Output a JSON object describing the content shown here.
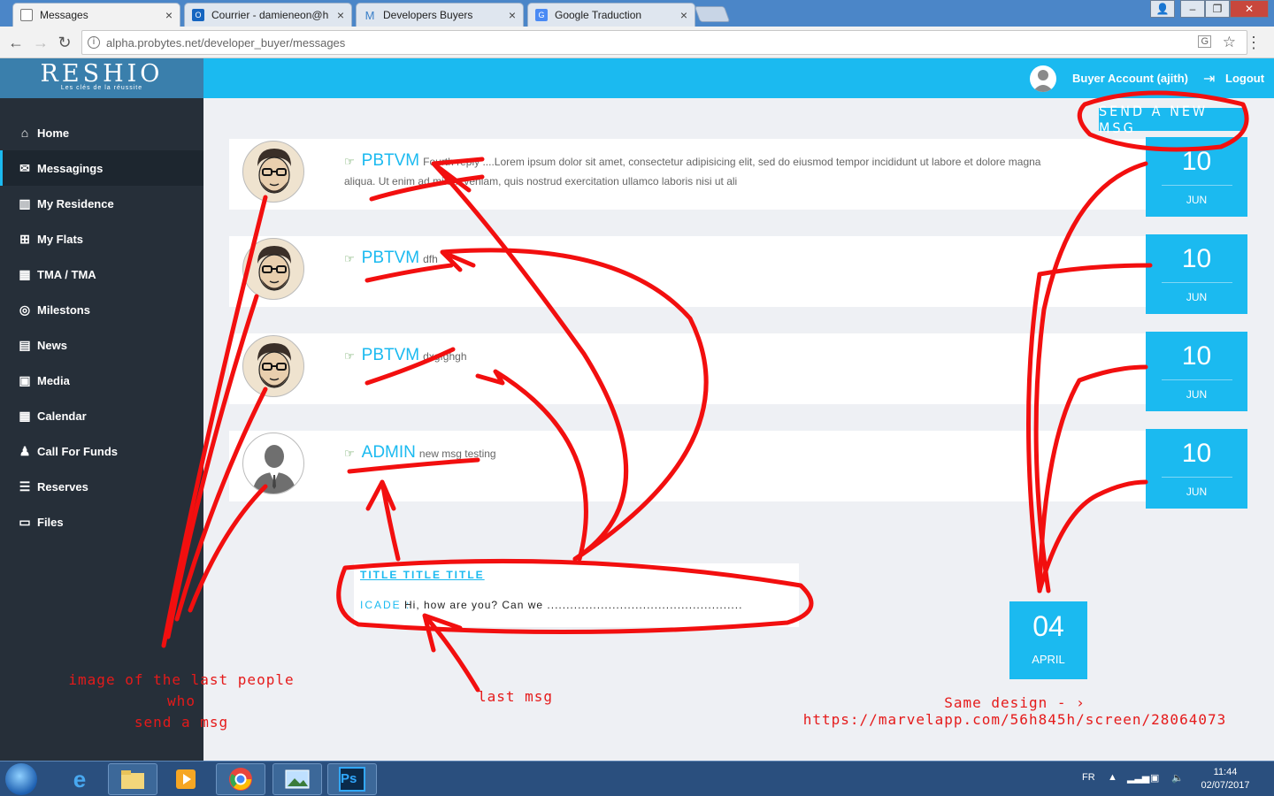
{
  "browser": {
    "tabs": [
      {
        "label": "Messages",
        "icon": "document-icon",
        "active": true
      },
      {
        "label": "Courrier - damieneon@h",
        "icon": "outlook-icon",
        "active": false
      },
      {
        "label": "Developers Buyers",
        "icon": "marvel-icon",
        "active": false
      },
      {
        "label": "Google Traduction",
        "icon": "google-translate-icon",
        "active": false
      }
    ],
    "url": "alpha.probytes.net/developer_buyer/messages",
    "window_controls": {
      "minimize": "–",
      "maximize": "❐",
      "close": "✕"
    }
  },
  "app": {
    "logo_main": "RESHIO",
    "logo_tagline": "Les clés de la réussite",
    "account_label": "Buyer Account (ajith)",
    "logout_label": "Logout",
    "accent_color": "#1bbaf0",
    "sidebar_color": "#262f39"
  },
  "sidebar": {
    "items": [
      {
        "label": "Home",
        "icon": "home-icon",
        "active": false
      },
      {
        "label": "Messagings",
        "icon": "envelope-icon",
        "active": true
      },
      {
        "label": "My Residence",
        "icon": "building-icon",
        "active": false
      },
      {
        "label": "My Flats",
        "icon": "grid-icon",
        "active": false
      },
      {
        "label": "TMA / TMA",
        "icon": "tma-icon",
        "active": false
      },
      {
        "label": "Milestons",
        "icon": "target-icon",
        "active": false
      },
      {
        "label": "News",
        "icon": "newspaper-icon",
        "active": false
      },
      {
        "label": "Media",
        "icon": "image-icon",
        "active": false
      },
      {
        "label": "Calendar",
        "icon": "calendar-icon",
        "active": false
      },
      {
        "label": "Call For Funds",
        "icon": "users-icon",
        "active": false
      },
      {
        "label": "Reserves",
        "icon": "list-icon",
        "active": false
      },
      {
        "label": "Files",
        "icon": "folder-icon",
        "active": false
      }
    ]
  },
  "main": {
    "send_button_label": "SEND A NEW MSG",
    "messages": [
      {
        "sender": "PBTVM",
        "text": "Fourth reply ....Lorem ipsum dolor sit amet, consectetur adipisicing elit, sed do eiusmod tempor incididunt ut labore et dolore magna aliqua. Ut enim ad minim veniam, quis nostrud exercitation ullamco laboris nisi ut ali",
        "day": "10",
        "month": "JUN",
        "avatar": "cartoon"
      },
      {
        "sender": "PBTVM",
        "text": "dfh",
        "day": "10",
        "month": "JUN",
        "avatar": "cartoon"
      },
      {
        "sender": "PBTVM",
        "text": "dxgfghgh",
        "day": "10",
        "month": "JUN",
        "avatar": "cartoon"
      },
      {
        "sender": "ADMIN",
        "text": "new msg testing",
        "day": "10",
        "month": "JUN",
        "avatar": "default"
      }
    ],
    "preview": {
      "title": "TITLE TITLE TITLE",
      "from": "ICADE :",
      "body": "Hi, how are you? Can we ..................................................."
    },
    "alt_date": {
      "day": "04",
      "month": "APRIL"
    }
  },
  "annotations": {
    "avatar_note_line1": "image of the last people who",
    "avatar_note_line2": "send a msg",
    "last_msg_note": "last msg",
    "same_design_note": "Same design - › https://marvelapp.com/56h845h/screen/28064073",
    "annotation_color": "#e51a1a"
  },
  "taskbar": {
    "language": "FR",
    "time": "11:44",
    "date": "02/07/2017"
  }
}
